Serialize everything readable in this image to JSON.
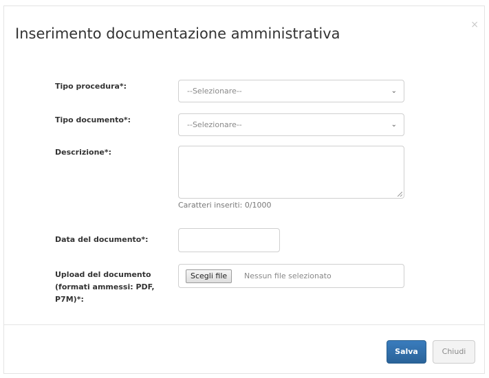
{
  "modal": {
    "title": "Inserimento documentazione amministrativa",
    "close_glyph": "×"
  },
  "form": {
    "tipo_procedura": {
      "label": "Tipo procedura*:",
      "selected": "--Selezionare--"
    },
    "tipo_documento": {
      "label": "Tipo documento*:",
      "selected": "--Selezionare--"
    },
    "descrizione": {
      "label": "Descrizione*:",
      "value": "",
      "char_counter": "Caratteri inseriti: 0/1000"
    },
    "data_documento": {
      "label": "Data del documento*:",
      "value": ""
    },
    "upload": {
      "label_line1": "Upload del documento",
      "label_line2": "(formati ammessi: PDF,",
      "label_line3": "P7M)*:",
      "button_label": "Scegli file",
      "status": "Nessun file selezionato"
    }
  },
  "footer": {
    "save_label": "Salva",
    "close_label": "Chiudi"
  },
  "colors": {
    "primary_button": "#2e6da4",
    "secondary_button": "#f3f3f3"
  },
  "icons": {
    "close": "close-icon",
    "select_arrow": "chevron-down-icon",
    "resize": "resize-grip-icon"
  }
}
